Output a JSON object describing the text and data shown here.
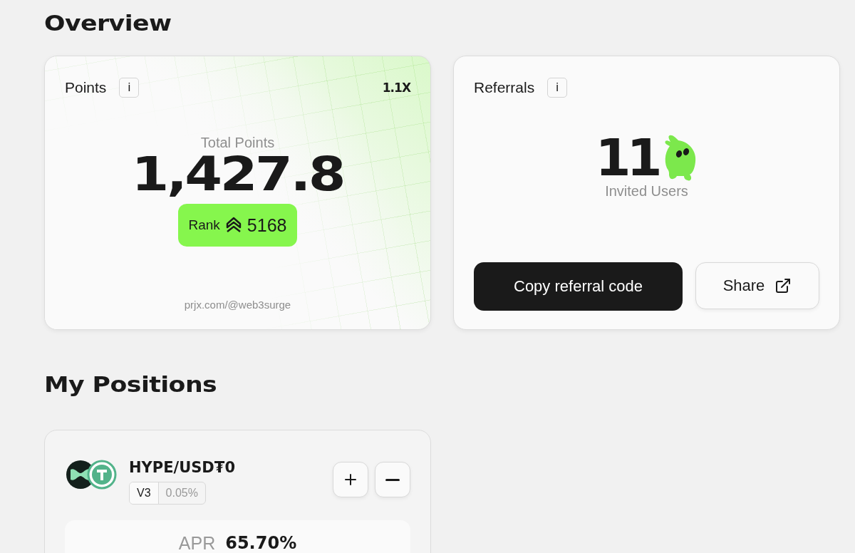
{
  "overview": {
    "title": "Overview",
    "points_card": {
      "title": "Points",
      "info": "i",
      "multiplier": "1.1X",
      "total_label": "Total Points",
      "total_value": "1,427.8",
      "rank_label": "Rank",
      "rank_value": "5168",
      "link": "prjx.com/@web3surge"
    },
    "referrals_card": {
      "title": "Referrals",
      "info": "i",
      "count": "11",
      "count_label": "Invited Users",
      "buttons": [
        {
          "label": "Copy referral code",
          "kind": "primary"
        },
        {
          "label": "Share",
          "kind": "share"
        }
      ]
    }
  },
  "positions": {
    "title": "My Positions",
    "items": [
      {
        "pair": "HYPE/USD₮0",
        "version": "V3",
        "fee": "0.05%",
        "apr_label": "APR",
        "apr_value": "65.70%"
      }
    ]
  }
}
